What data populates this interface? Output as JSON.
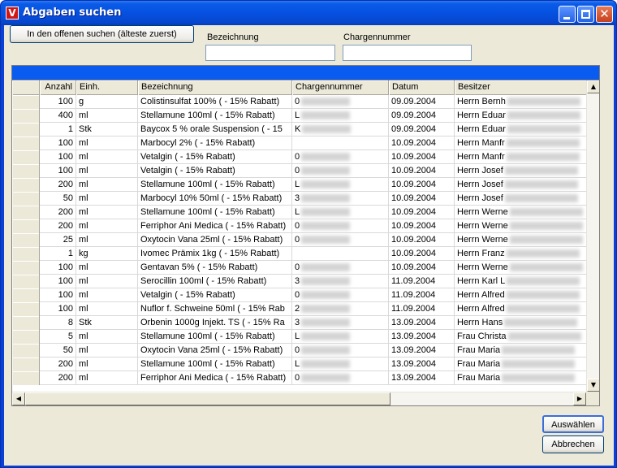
{
  "window": {
    "title": "Abgaben suchen",
    "app_icon_letter": "V"
  },
  "toolbar": {
    "search_oldest_label": "In den offenen suchen (älteste zuerst)",
    "bezeichnung_label": "Bezeichnung",
    "bezeichnung_value": "",
    "chargennummer_label": "Chargennummer",
    "chargennummer_value": ""
  },
  "table": {
    "columns": [
      "Anzahl",
      "Einh.",
      "Bezeichnung",
      "Chargennummer",
      "Datum",
      "Besitzer"
    ],
    "rows": [
      {
        "anzahl": "100",
        "einh": "g",
        "bez": "Colistinsulfat 100% ( - 15% Rabatt)",
        "charge": "0",
        "datum": "09.09.2004",
        "besitzer": "Herrn Bernh"
      },
      {
        "anzahl": "400",
        "einh": "ml",
        "bez": "Stellamune 100ml ( - 15% Rabatt)",
        "charge": "L",
        "datum": "09.09.2004",
        "besitzer": "Herrn Eduar"
      },
      {
        "anzahl": "1",
        "einh": "Stk",
        "bez": "Baycox 5 % orale Suspension ( - 15",
        "charge": "K",
        "datum": "09.09.2004",
        "besitzer": "Herrn Eduar"
      },
      {
        "anzahl": "100",
        "einh": "ml",
        "bez": "Marbocyl 2% ( - 15% Rabatt)",
        "charge": "",
        "datum": "10.09.2004",
        "besitzer": "Herrn Manfr"
      },
      {
        "anzahl": "100",
        "einh": "ml",
        "bez": "Vetalgin ( - 15% Rabatt)",
        "charge": "0",
        "datum": "10.09.2004",
        "besitzer": "Herrn Manfr"
      },
      {
        "anzahl": "100",
        "einh": "ml",
        "bez": "Vetalgin ( - 15% Rabatt)",
        "charge": "0",
        "datum": "10.09.2004",
        "besitzer": "Herrn Josef"
      },
      {
        "anzahl": "200",
        "einh": "ml",
        "bez": "Stellamune 100ml ( - 15% Rabatt)",
        "charge": "L",
        "datum": "10.09.2004",
        "besitzer": "Herrn Josef"
      },
      {
        "anzahl": "50",
        "einh": "ml",
        "bez": "Marbocyl 10%  50ml ( - 15% Rabatt)",
        "charge": "3",
        "datum": "10.09.2004",
        "besitzer": "Herrn Josef"
      },
      {
        "anzahl": "200",
        "einh": "ml",
        "bez": "Stellamune 100ml ( - 15% Rabatt)",
        "charge": "L",
        "datum": "10.09.2004",
        "besitzer": "Herrn Werne"
      },
      {
        "anzahl": "200",
        "einh": "ml",
        "bez": "Ferriphor Ani Medica ( - 15% Rabatt)",
        "charge": "0",
        "datum": "10.09.2004",
        "besitzer": "Herrn Werne"
      },
      {
        "anzahl": "25",
        "einh": "ml",
        "bez": "Oxytocin Vana 25ml ( - 15% Rabatt)",
        "charge": "0",
        "datum": "10.09.2004",
        "besitzer": "Herrn Werne"
      },
      {
        "anzahl": "1",
        "einh": "kg",
        "bez": "Ivomec Prämix 1kg ( - 15% Rabatt)",
        "charge": "",
        "datum": "10.09.2004",
        "besitzer": "Herrn Franz"
      },
      {
        "anzahl": "100",
        "einh": "ml",
        "bez": "Gentavan 5% ( - 15% Rabatt)",
        "charge": "0",
        "datum": "10.09.2004",
        "besitzer": "Herrn Werne"
      },
      {
        "anzahl": "100",
        "einh": "ml",
        "bez": "Serocillin 100ml ( - 15% Rabatt)",
        "charge": "3",
        "datum": "11.09.2004",
        "besitzer": "Herrn Karl L"
      },
      {
        "anzahl": "100",
        "einh": "ml",
        "bez": "Vetalgin ( - 15% Rabatt)",
        "charge": "0",
        "datum": "11.09.2004",
        "besitzer": "Herrn Alfred"
      },
      {
        "anzahl": "100",
        "einh": "ml",
        "bez": "Nuflor f. Schweine 50ml ( - 15% Rab",
        "charge": "2",
        "datum": "11.09.2004",
        "besitzer": "Herrn Alfred"
      },
      {
        "anzahl": "8",
        "einh": "Stk",
        "bez": "Orbenin 1000g Injekt. TS ( - 15% Ra",
        "charge": "3",
        "datum": "13.09.2004",
        "besitzer": "Herrn Hans"
      },
      {
        "anzahl": "5",
        "einh": "ml",
        "bez": "Stellamune 100ml ( - 15% Rabatt)",
        "charge": "L",
        "datum": "13.09.2004",
        "besitzer": "Frau Christa"
      },
      {
        "anzahl": "50",
        "einh": "ml",
        "bez": "Oxytocin Vana 25ml ( - 15% Rabatt)",
        "charge": "0",
        "datum": "13.09.2004",
        "besitzer": "Frau Maria"
      },
      {
        "anzahl": "200",
        "einh": "ml",
        "bez": "Stellamune 100ml ( - 15% Rabatt)",
        "charge": "L",
        "datum": "13.09.2004",
        "besitzer": "Frau Maria"
      },
      {
        "anzahl": "200",
        "einh": "ml",
        "bez": "Ferriphor Ani Medica ( - 15% Rabatt)",
        "charge": "0",
        "datum": "13.09.2004",
        "besitzer": "Frau Maria"
      }
    ]
  },
  "actions": {
    "select_label": "Auswählen",
    "cancel_label": "Abbrechen"
  }
}
